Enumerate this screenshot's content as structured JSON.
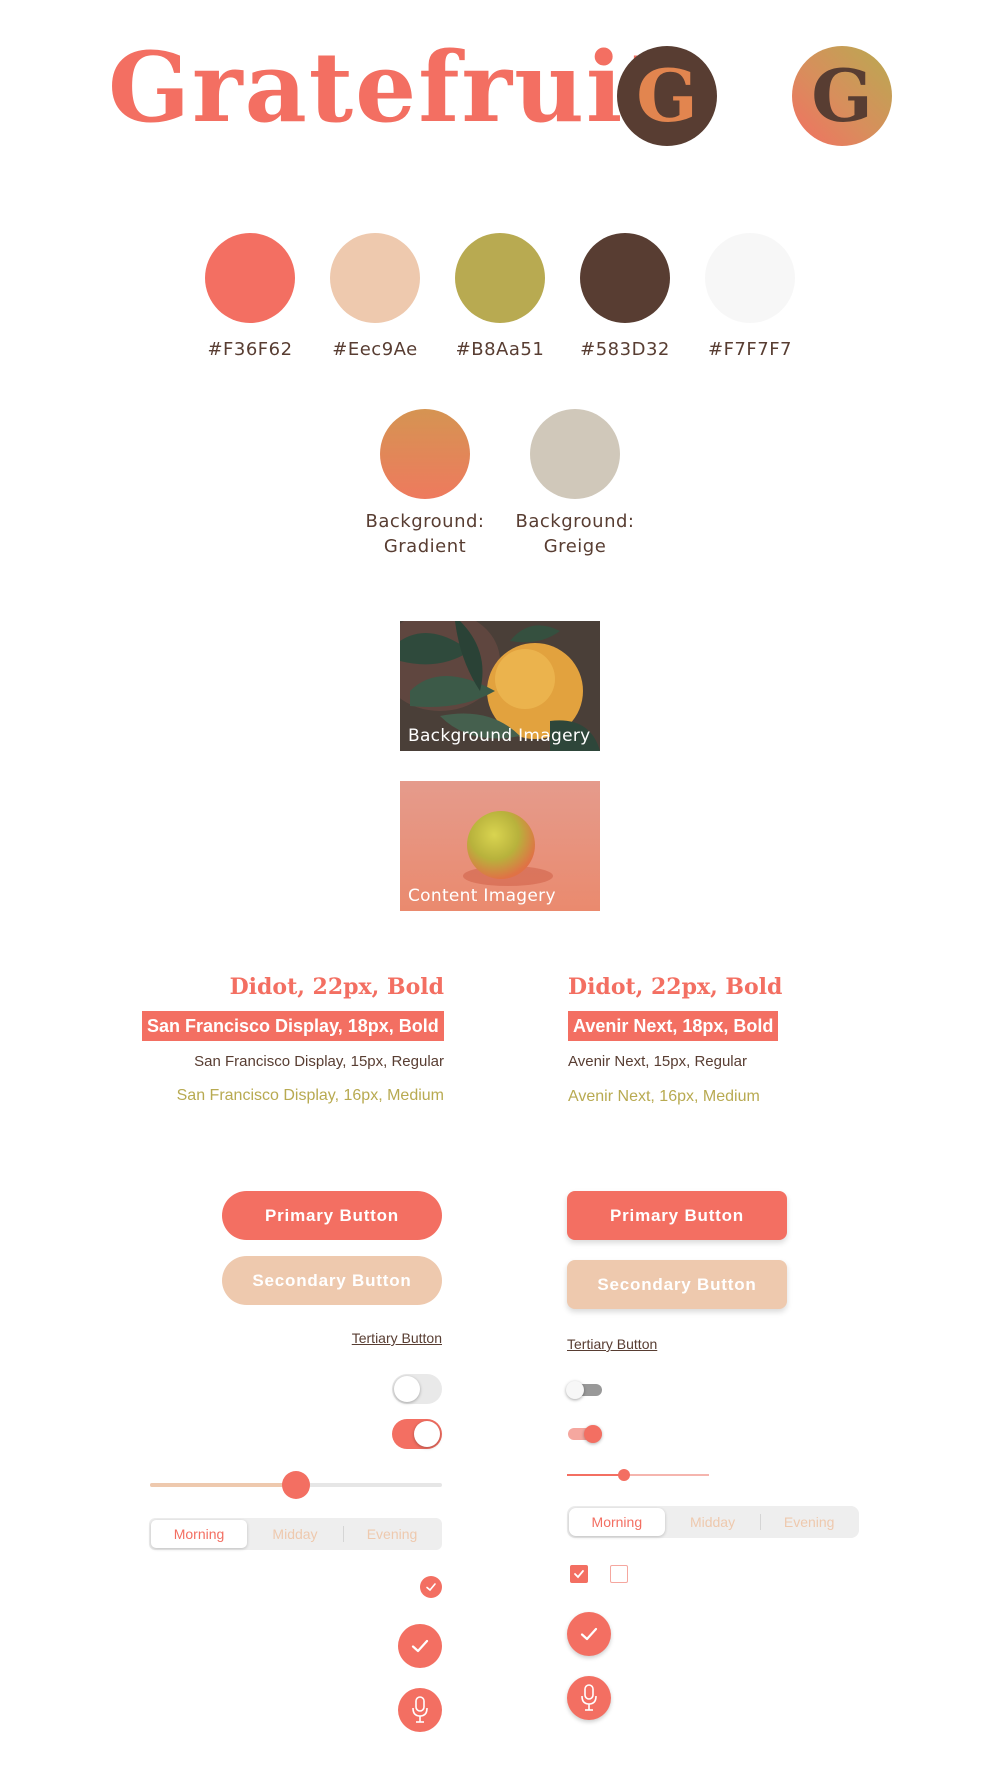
{
  "brand": {
    "name": "Gratefruit",
    "logo_letter": "G"
  },
  "palette": [
    {
      "hex": "#F36F62",
      "label": "#F36F62"
    },
    {
      "hex": "#EEC9AE",
      "label": "#Eec9Ae"
    },
    {
      "hex": "#B8AA51",
      "label": "#B8Aa51"
    },
    {
      "hex": "#583D32",
      "label": "#583D32"
    },
    {
      "hex": "#F7F7F7",
      "label": "#F7F7F7"
    }
  ],
  "backgrounds": [
    {
      "label": "Background:",
      "sub": "Gradient"
    },
    {
      "label": "Background:",
      "sub": "Greige",
      "hex": "#D0C8BA"
    }
  ],
  "imagery": {
    "background_caption": "Background Imagery",
    "content_caption": "Content Imagery"
  },
  "typography": {
    "left": {
      "heading": "Didot, 22px, Bold",
      "bold": "San Francisco Display, 18px, Bold",
      "regular": "San Francisco Display, 15px, Regular",
      "medium": "San Francisco Display, 16px, Medium"
    },
    "right": {
      "heading": "Didot, 22px, Bold",
      "bold": "Avenir Next, 18px, Bold",
      "regular": "Avenir Next, 15px, Regular",
      "medium": "Avenir Next, 16px, Medium"
    }
  },
  "buttons": {
    "primary": "Primary Button",
    "secondary": "Secondary Button",
    "tertiary": "Tertiary Button"
  },
  "segmented": {
    "options": [
      "Morning",
      "Midday",
      "Evening"
    ],
    "selected": "Morning"
  },
  "controls": {
    "slider_left_value": 0.5,
    "slider_right_value": 0.4,
    "toggles": [
      "off",
      "on"
    ],
    "checkboxes": [
      "checked",
      "unchecked"
    ]
  },
  "icons": [
    "check-icon",
    "microphone-icon"
  ],
  "colors": {
    "accent": "#F36F62",
    "peach": "#EEC9AE",
    "olive": "#B8AA51",
    "brown": "#583D32",
    "light": "#F7F7F7"
  }
}
